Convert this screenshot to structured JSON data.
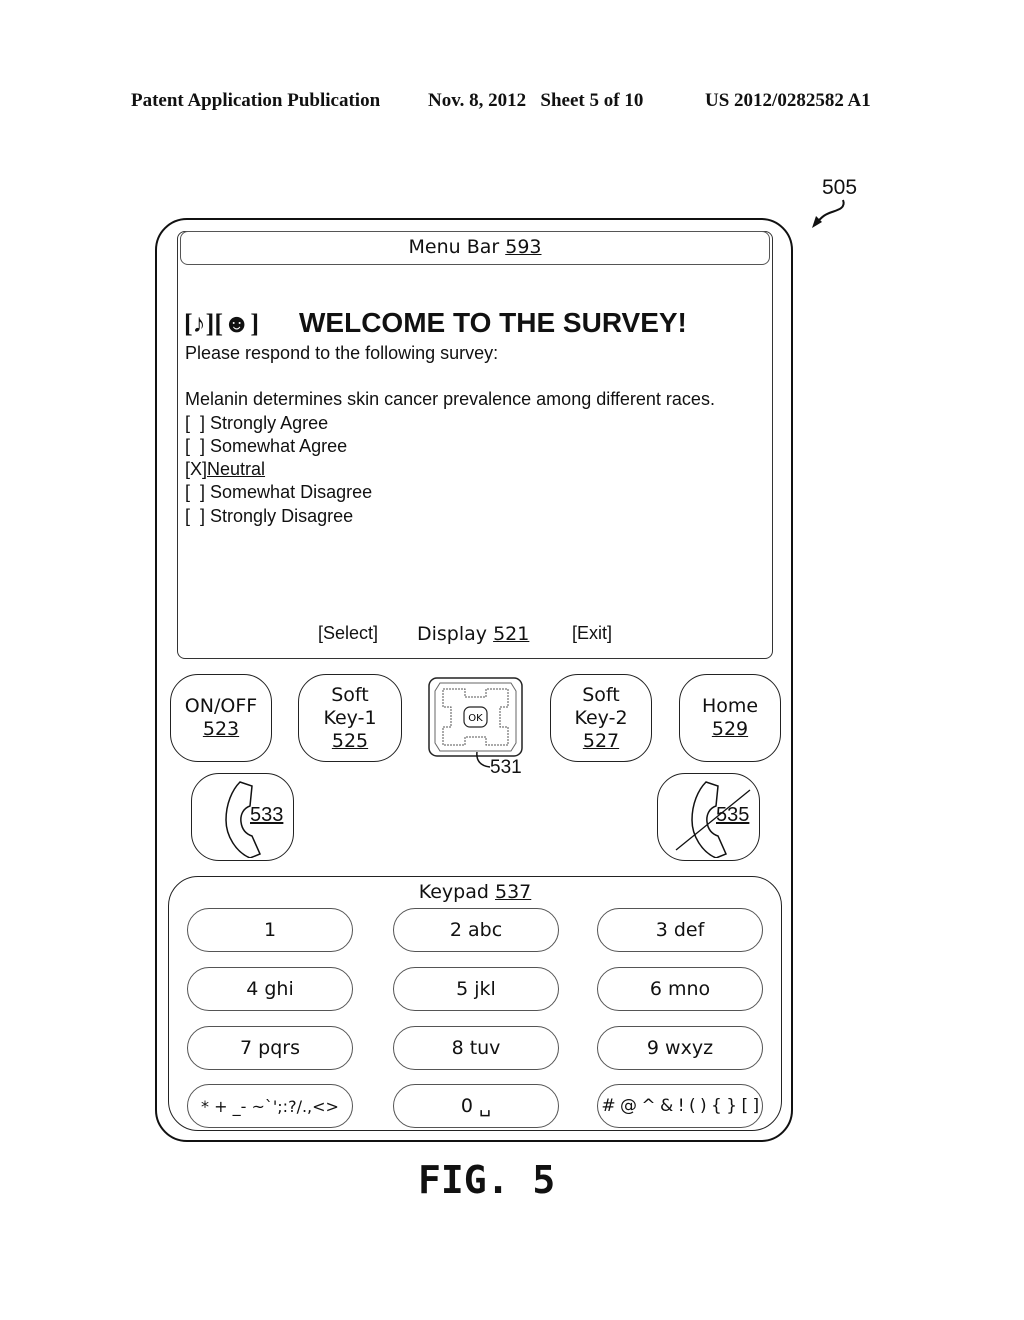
{
  "header": {
    "left": "Patent Application Publication",
    "middle": "Nov. 8, 2012   Sheet 5 of 10",
    "right": "US 2012/0282582 A1"
  },
  "device_ref": "505",
  "menu_bar": {
    "label": "Menu Bar",
    "ref": "593"
  },
  "screen": {
    "status_icons": "[♪][☻]",
    "status_icon_names": [
      "music-note-icon",
      "smiley-icon"
    ],
    "title": "WELCOME TO THE SURVEY!",
    "subtitle": "Please respond to the following survey:",
    "question": "Melanin determines skin cancer prevalence among different races.",
    "options": [
      {
        "mark": "[  ]",
        "label": "Strongly Agree",
        "selected": false
      },
      {
        "mark": "[  ]",
        "label": "Somewhat Agree",
        "selected": false
      },
      {
        "mark": "[X]",
        "label": "Neutral",
        "selected": true
      },
      {
        "mark": "[  ]",
        "label": "Somewhat Disagree",
        "selected": false
      },
      {
        "mark": "[  ]",
        "label": "Strongly Disagree",
        "selected": false
      }
    ],
    "softkey_left": "[Select]",
    "softkey_right": "[Exit]",
    "display_label": "Display",
    "display_ref": "521"
  },
  "buttons": {
    "onoff": {
      "label": "ON/OFF",
      "ref": "523"
    },
    "soft1": {
      "line1": "Soft",
      "line2": "Key-1",
      "ref": "525"
    },
    "soft2": {
      "line1": "Soft",
      "line2": "Key-2",
      "ref": "527"
    },
    "home": {
      "label": "Home",
      "ref": "529"
    },
    "nav": {
      "center_label": "OK",
      "ref": "531"
    },
    "call": {
      "ref": "533"
    },
    "end": {
      "ref": "535"
    }
  },
  "keypad": {
    "label": "Keypad",
    "ref": "537",
    "keys": [
      "1",
      "2 abc",
      "3 def",
      "4 ghi",
      "5 jkl",
      "6 mno",
      "7 pqrs",
      "8 tuv",
      "9 wxyz",
      "* + _- ~`';:?/.,<>",
      "0 ␣",
      "# @ ^ & ! ( ) { } [ ]"
    ]
  },
  "figure_label": "FIG. 5"
}
